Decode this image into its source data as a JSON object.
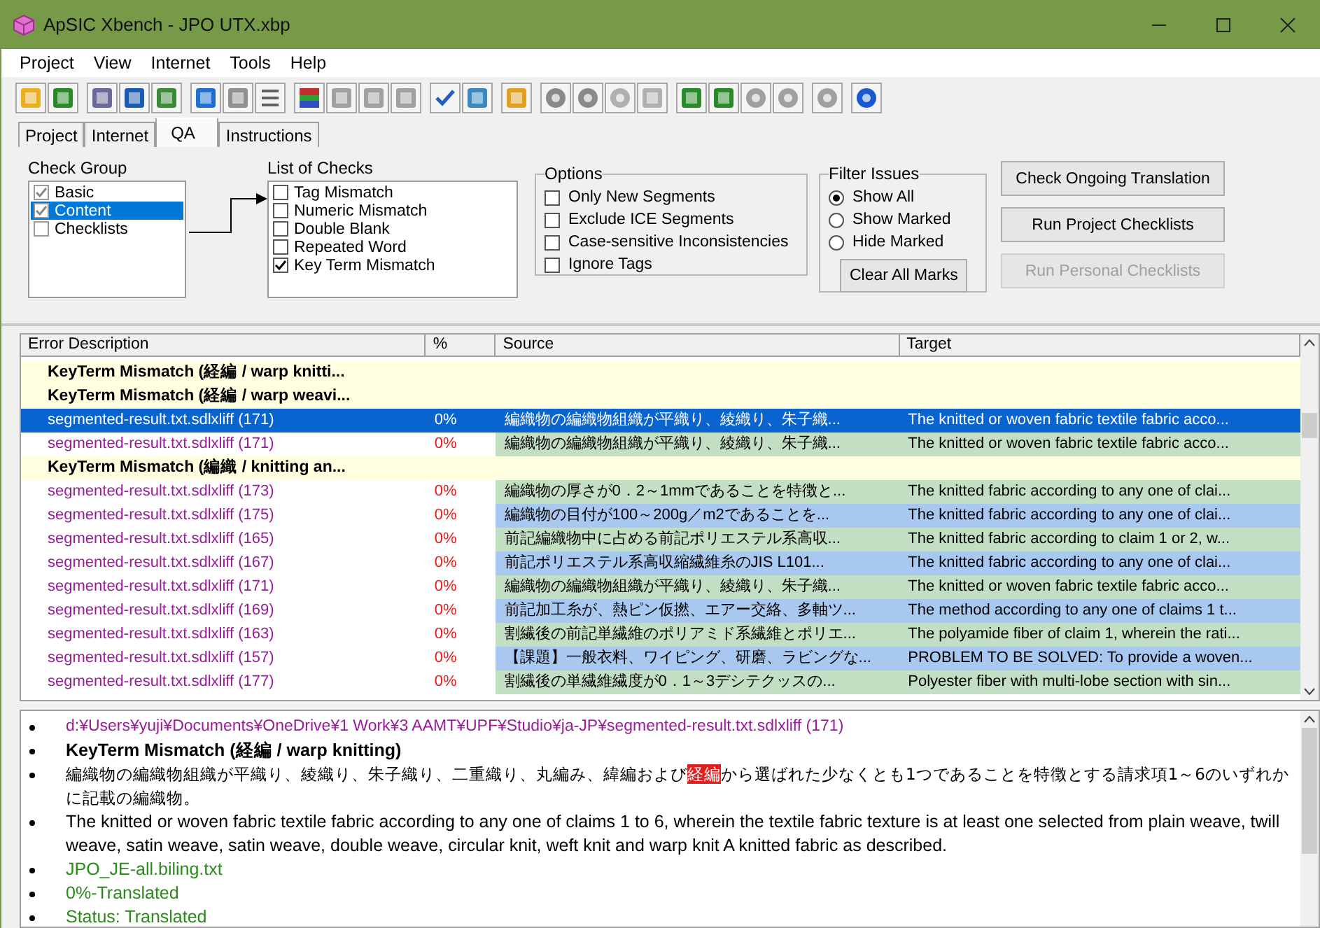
{
  "window": {
    "title": "ApSIC Xbench - JPO UTX.xbp"
  },
  "menu": [
    "Project",
    "View",
    "Internet",
    "Tools",
    "Help"
  ],
  "tabs": [
    {
      "label": "Project",
      "selected": false
    },
    {
      "label": "Internet",
      "selected": false
    },
    {
      "label": "QA",
      "selected": true
    },
    {
      "label": "Instructions",
      "selected": false
    }
  ],
  "check_group": {
    "label": "Check Group",
    "items": [
      {
        "label": "Basic",
        "checked": true,
        "selected": false
      },
      {
        "label": "Content",
        "checked": true,
        "selected": true
      },
      {
        "label": "Checklists",
        "checked": false,
        "selected": false
      }
    ]
  },
  "list_of_checks": {
    "label": "List of Checks",
    "items": [
      {
        "label": "Tag Mismatch",
        "checked": false
      },
      {
        "label": "Numeric Mismatch",
        "checked": false
      },
      {
        "label": "Double Blank",
        "checked": false
      },
      {
        "label": "Repeated Word",
        "checked": false
      },
      {
        "label": "Key Term Mismatch",
        "checked": true
      }
    ]
  },
  "options": {
    "label": "Options",
    "items": [
      {
        "label": "Only New Segments",
        "checked": false
      },
      {
        "label": "Exclude ICE Segments",
        "checked": false
      },
      {
        "label": "Case-sensitive Inconsistencies",
        "checked": false
      },
      {
        "label": "Ignore Tags",
        "checked": false
      }
    ]
  },
  "filter_issues": {
    "label": "Filter Issues",
    "items": [
      {
        "label": "Show All",
        "selected": true
      },
      {
        "label": "Show Marked",
        "selected": false
      },
      {
        "label": "Hide Marked",
        "selected": false
      }
    ],
    "button": "Clear All Marks"
  },
  "buttons": [
    {
      "label": "Check Ongoing Translation",
      "disabled": false
    },
    {
      "label": "Run Project Checklists",
      "disabled": false
    },
    {
      "label": "Run Personal Checklists",
      "disabled": true
    }
  ],
  "table": {
    "columns": [
      "Error Description",
      "%",
      "Source",
      "Target"
    ],
    "rows": [
      {
        "kind": "group",
        "text": "KeyTerm Mismatch (経編 / warp knitti..."
      },
      {
        "kind": "group",
        "text": "KeyTerm Mismatch (経編 / warp weavi..."
      },
      {
        "kind": "issue",
        "selected": true,
        "file": "segmented-result.txt.sdlxliff (171)",
        "percent": "0%",
        "source": "編織物の編織物組織が平織り、綾織り、朱子織...",
        "target": "The knitted or woven fabric textile fabric acco..."
      },
      {
        "kind": "issue",
        "selected": false,
        "color": "#c3dfc3",
        "file": "segmented-result.txt.sdlxliff (171)",
        "percent": "0%",
        "source": "編織物の編織物組織が平織り、綾織り、朱子織...",
        "target": "The knitted or woven fabric textile fabric acco..."
      },
      {
        "kind": "group",
        "text": "KeyTerm Mismatch (編織 / knitting an..."
      },
      {
        "kind": "issue",
        "selected": false,
        "color": "#c3dfc3",
        "file": "segmented-result.txt.sdlxliff (173)",
        "percent": "0%",
        "source": "編織物の厚さが0．2～1mmであることを特徴と...",
        "target": "The knitted fabric according to any one of clai..."
      },
      {
        "kind": "issue",
        "selected": false,
        "color": "#a9c8ef",
        "file": "segmented-result.txt.sdlxliff (175)",
        "percent": "0%",
        "source": "編織物の目付が100～200g／m2であることを...",
        "target": "The knitted fabric according to any one of clai..."
      },
      {
        "kind": "issue",
        "selected": false,
        "color": "#c3dfc3",
        "file": "segmented-result.txt.sdlxliff (165)",
        "percent": "0%",
        "source": "前記編織物中に占める前記ポリエステル系高収...",
        "target": "The knitted fabric according to claim 1 or 2, w..."
      },
      {
        "kind": "issue",
        "selected": false,
        "color": "#a9c8ef",
        "file": "segmented-result.txt.sdlxliff (167)",
        "percent": "0%",
        "source": "前記ポリエステル系高収縮繊維糸のJIS L101...",
        "target": "The knitted fabric according to any one of clai..."
      },
      {
        "kind": "issue",
        "selected": false,
        "color": "#c3dfc3",
        "file": "segmented-result.txt.sdlxliff (171)",
        "percent": "0%",
        "source": "編織物の編織物組織が平織り、綾織り、朱子織...",
        "target": "The knitted or woven fabric textile fabric acco..."
      },
      {
        "kind": "issue",
        "selected": false,
        "color": "#a9c8ef",
        "file": "segmented-result.txt.sdlxliff (169)",
        "percent": "0%",
        "source": "前記加工糸が、熱ピン仮撚、エアー交絡、多軸ツ...",
        "target": "The method according to any one of claims 1 t..."
      },
      {
        "kind": "issue",
        "selected": false,
        "color": "#c3dfc3",
        "file": "segmented-result.txt.sdlxliff (163)",
        "percent": "0%",
        "source": "割繊後の前記単繊維のポリアミド系繊維とポリエ...",
        "target": "The polyamide fiber of claim 1, wherein the rati..."
      },
      {
        "kind": "issue",
        "selected": false,
        "color": "#a9c8ef",
        "file": "segmented-result.txt.sdlxliff (157)",
        "percent": "0%",
        "source": "【課題】一般衣料、ワイピング、研磨、ラビングな...",
        "target": "PROBLEM TO BE SOLVED: To provide a woven..."
      },
      {
        "kind": "issue",
        "selected": false,
        "color": "#c3dfc3",
        "file": "segmented-result.txt.sdlxliff (177)",
        "percent": "0%",
        "source": "割繊後の単繊維繊度が0．1～3デシテクッスの...",
        "target": "Polyester fiber with multi-lobe section with sin..."
      }
    ]
  },
  "details": [
    {
      "kind": "path",
      "text": "d:¥Users¥yuji¥Documents¥OneDrive¥1 Work¥3 AAMT¥UPF¥Studio¥ja-JP¥segmented-result.txt.sdlxliff (171)"
    },
    {
      "kind": "title",
      "text": "KeyTerm Mismatch (経編 / warp knitting)"
    },
    {
      "kind": "source",
      "parts": [
        {
          "text": "編織物の編織物組織が平織り、綾織り、朱子織り、二重織り、丸編み、緯編および",
          "highlight": false
        },
        {
          "text": "経編",
          "highlight": true
        },
        {
          "text": "から選ばれた少なくとも1つであることを特徴とする請求項1～6のいずれかに記載の編織物。",
          "highlight": false
        }
      ]
    },
    {
      "kind": "target",
      "text": "The knitted or woven fabric textile fabric according to any one of claims 1 to 6, wherein the textile fabric texture is at least one selected from plain weave, twill weave, satin weave, satin weave, double weave, circular knit, weft knit and warp knit A knitted fabric as described."
    },
    {
      "kind": "info",
      "text": "JPO_JE-all.biling.txt"
    },
    {
      "kind": "info",
      "text": "0%-Translated"
    },
    {
      "kind": "info",
      "text": "Status: Translated"
    }
  ]
}
